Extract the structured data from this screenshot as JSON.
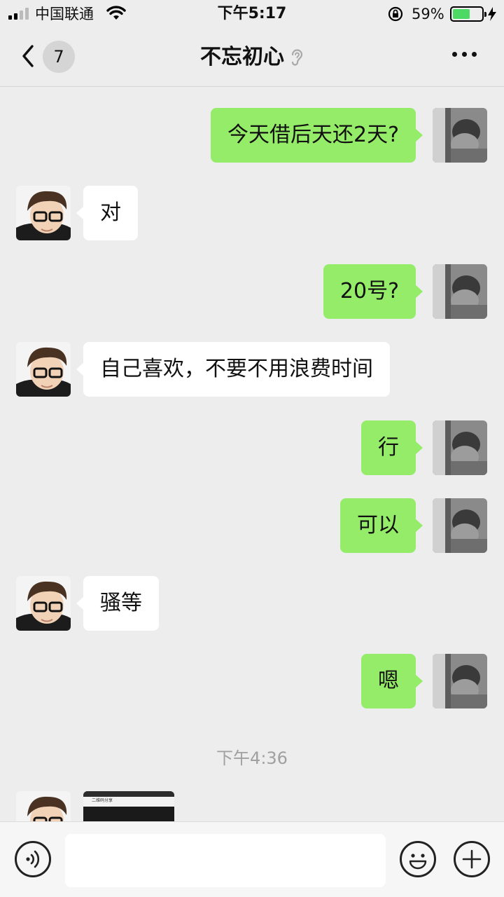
{
  "status_bar": {
    "carrier": "中国联通",
    "time": "下午5:17",
    "battery_percent": "59%",
    "battery_level": 0.59,
    "icons": [
      "signal-icon",
      "wifi-icon",
      "rotation-lock-icon",
      "battery-icon",
      "charging-icon"
    ]
  },
  "nav": {
    "back_icon": "chevron-left-icon",
    "unread_count": "7",
    "title": "不忘初心",
    "mute_icon": "ear-icon",
    "more_icon": "more-dots-icon"
  },
  "messages": [
    {
      "sender": "me",
      "text": "今天借后天还2天?"
    },
    {
      "sender": "other",
      "text": "对"
    },
    {
      "sender": "me",
      "text": "20号?"
    },
    {
      "sender": "other",
      "text": "自己喜欢，不要不用浪费时间"
    },
    {
      "sender": "me",
      "text": "行"
    },
    {
      "sender": "me",
      "text": "可以"
    },
    {
      "sender": "other",
      "text": "骚等"
    },
    {
      "sender": "me",
      "text": "嗯"
    }
  ],
  "timestamp": "下午4:36",
  "image_message": {
    "sender": "other",
    "caption": "二维码分享"
  },
  "input_bar": {
    "voice_icon": "voice-icon",
    "emoji_icon": "emoji-icon",
    "plus_icon": "plus-icon",
    "input_value": ""
  },
  "colors": {
    "background": "#ededed",
    "my_bubble": "#95ec69",
    "their_bubble": "#ffffff",
    "battery_fill": "#4cd964"
  }
}
